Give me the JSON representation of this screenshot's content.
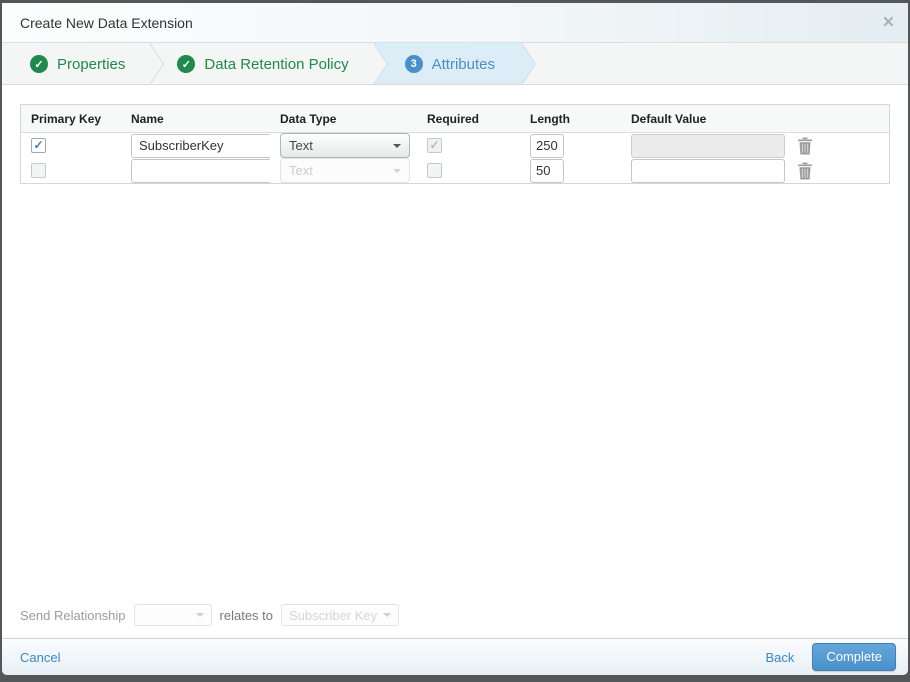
{
  "modal": {
    "title": "Create New Data Extension",
    "close_icon": "×"
  },
  "wizard": {
    "steps": [
      {
        "label": "Properties",
        "status": "complete"
      },
      {
        "label": "Data Retention Policy",
        "status": "complete"
      },
      {
        "label": "Attributes",
        "status": "active",
        "number": "3"
      }
    ]
  },
  "table": {
    "headers": [
      "Primary Key",
      "Name",
      "Data Type",
      "Required",
      "Length",
      "Default Value"
    ],
    "rows": [
      {
        "primary_key_checked": true,
        "name": "SubscriberKey",
        "data_type": "Text",
        "data_type_disabled": false,
        "required_checked": true,
        "required_disabled": true,
        "length": "250",
        "default_value": "",
        "default_disabled": true
      },
      {
        "primary_key_checked": false,
        "name": "",
        "data_type": "Text",
        "data_type_disabled": true,
        "required_checked": false,
        "required_disabled": false,
        "length": "50",
        "default_value": "",
        "default_disabled": false
      }
    ]
  },
  "send_relationship": {
    "label": "Send Relationship",
    "relates_to": "relates to",
    "target": "Subscriber Key"
  },
  "footer": {
    "cancel": "Cancel",
    "back": "Back",
    "complete": "Complete"
  },
  "colors": {
    "step_complete_green": "#1f8a4c",
    "step_active_blue": "#4a90c8",
    "step_active_bg": "#ddedf8",
    "link_blue": "#3a87c8",
    "complete_button_blue": "#4a90ca"
  }
}
